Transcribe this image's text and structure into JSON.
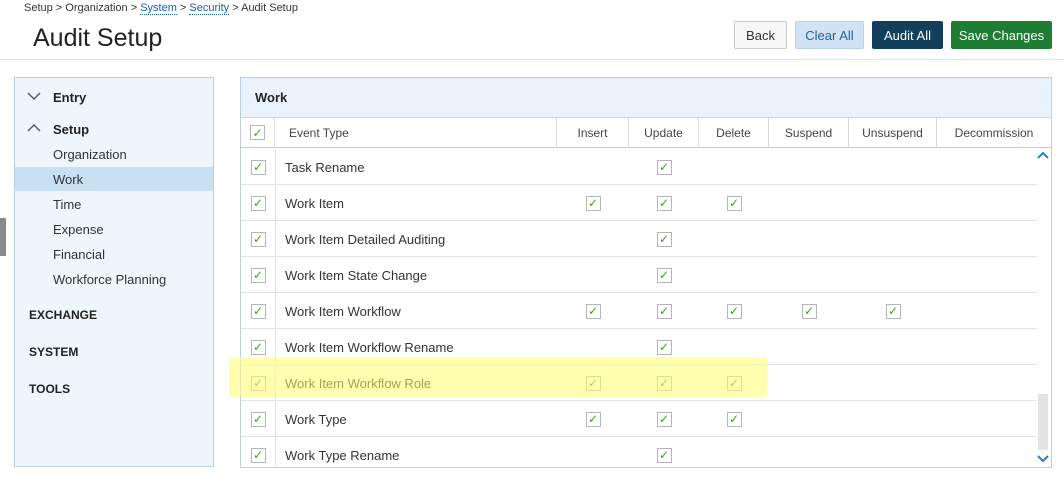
{
  "breadcrumb": {
    "part1": "Setup > Organization > ",
    "system": "System",
    "sep": " > ",
    "security": "Security",
    "part2": " > Audit Setup"
  },
  "page": {
    "title": "Audit Setup"
  },
  "toolbar": {
    "back_label": "Back",
    "clear_all_label": "Clear All",
    "audit_all_label": "Audit All",
    "save_label": "Save Changes"
  },
  "sidebar": {
    "sections": [
      {
        "label": "Entry",
        "chevron": ">"
      },
      {
        "label": "Setup",
        "chevron": "^"
      }
    ],
    "items": [
      "Organization",
      "Work",
      "Time",
      "Expense",
      "Financial",
      "Workforce Planning"
    ],
    "active_item": "Work",
    "groups": [
      "EXCHANGE",
      "SYSTEM",
      "TOOLS"
    ]
  },
  "panel": {
    "title": "Work",
    "columns": [
      "Event Type",
      "Insert",
      "Update",
      "Delete",
      "Suspend",
      "Unsuspend",
      "Decommission"
    ],
    "rows": [
      {
        "name": "Task Rename",
        "insert": false,
        "update": true,
        "delete": false,
        "suspend": false,
        "unsuspend": false,
        "decommission": false
      },
      {
        "name": "Work Item",
        "insert": true,
        "update": true,
        "delete": true,
        "suspend": false,
        "unsuspend": false,
        "decommission": false
      },
      {
        "name": "Work Item Detailed Auditing",
        "insert": false,
        "update": true,
        "delete": false,
        "suspend": false,
        "unsuspend": false,
        "decommission": false
      },
      {
        "name": "Work Item State Change",
        "insert": false,
        "update": true,
        "delete": false,
        "suspend": false,
        "unsuspend": false,
        "decommission": false
      },
      {
        "name": "Work Item Workflow",
        "insert": true,
        "update": true,
        "delete": true,
        "suspend": true,
        "unsuspend": true,
        "decommission": false
      },
      {
        "name": "Work Item Workflow Rename",
        "insert": false,
        "update": true,
        "delete": false,
        "suspend": false,
        "unsuspend": false,
        "decommission": false
      },
      {
        "name": "Work Item Workflow Role",
        "insert": true,
        "update": true,
        "delete": true,
        "suspend": false,
        "unsuspend": false,
        "decommission": false
      },
      {
        "name": "Work Type",
        "insert": true,
        "update": true,
        "delete": true,
        "suspend": false,
        "unsuspend": false,
        "decommission": false
      },
      {
        "name": "Work Type Rename",
        "insert": false,
        "update": true,
        "delete": false,
        "suspend": false,
        "unsuspend": false,
        "decommission": false
      }
    ],
    "highlighted_row": "Work Item Workflow Role"
  },
  "colors": {
    "accent": "#1e7d32",
    "navy": "#123f5c",
    "check": "#4a9a1f",
    "highlight": "#ffff6e"
  }
}
